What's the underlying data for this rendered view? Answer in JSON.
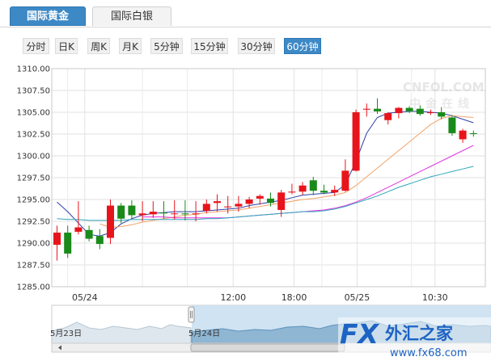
{
  "tabs": {
    "active_label": "国际黄金",
    "inactive_label": "国际白银"
  },
  "periods": [
    {
      "label": "分时",
      "selected": false
    },
    {
      "label": "日K",
      "selected": false
    },
    {
      "label": "周K",
      "selected": false
    },
    {
      "label": "月K",
      "selected": false
    },
    {
      "label": "5分钟",
      "selected": false
    },
    {
      "label": "15分钟",
      "selected": false
    },
    {
      "label": "30分钟",
      "selected": false
    },
    {
      "label": "60分钟",
      "selected": true
    }
  ],
  "watermarks": {
    "cnfol": "CNFOL.COM",
    "cnfol_sub": "中金在线",
    "fx": "FX",
    "fx_cn": "外汇之家",
    "fx_url": "www.fx68.com"
  },
  "navigator": {
    "labels": [
      "5月23日",
      "5月24日"
    ]
  },
  "colors": {
    "up": "#e8141b",
    "down": "#1a8a1a",
    "ma5": "#2f3fa8",
    "ma10": "#f3a268",
    "ma20": "#e236e2",
    "ma30": "#2ea6b8",
    "accent": "#3d89c6"
  },
  "chart_data": {
    "type": "candlestick",
    "title": "",
    "ylim": [
      1285,
      1310
    ],
    "yticks": [
      "1310.00",
      "1307.50",
      "1305.00",
      "1302.50",
      "1300.00",
      "1297.50",
      "1295.00",
      "1292.50",
      "1290.00",
      "1287.50",
      "1285.00"
    ],
    "xtick_labels": [
      {
        "label": "05/24",
        "index": 2.6
      },
      {
        "label": "12:00",
        "index": 16.5
      },
      {
        "label": "18:00",
        "index": 22.2
      },
      {
        "label": "05/25",
        "index": 28.1
      },
      {
        "label": "10:30",
        "index": 35.4
      }
    ],
    "grid": true,
    "candles": [
      {
        "o": 1289.8,
        "h": 1292.0,
        "l": 1288.0,
        "c": 1291.2
      },
      {
        "o": 1291.2,
        "h": 1292.0,
        "l": 1288.3,
        "c": 1288.8
      },
      {
        "o": 1291.3,
        "h": 1294.8,
        "l": 1291.0,
        "c": 1291.8
      },
      {
        "o": 1291.5,
        "h": 1292.0,
        "l": 1290.2,
        "c": 1290.5
      },
      {
        "o": 1290.8,
        "h": 1291.6,
        "l": 1289.3,
        "c": 1289.9
      },
      {
        "o": 1290.6,
        "h": 1295.0,
        "l": 1289.9,
        "c": 1294.3
      },
      {
        "o": 1294.3,
        "h": 1294.6,
        "l": 1292.3,
        "c": 1292.8
      },
      {
        "o": 1294.3,
        "h": 1294.9,
        "l": 1292.8,
        "c": 1293.2
      },
      {
        "o": 1293.2,
        "h": 1294.8,
        "l": 1292.5,
        "c": 1293.4
      },
      {
        "o": 1293.3,
        "h": 1294.8,
        "l": 1292.9,
        "c": 1293.6
      },
      {
        "o": 1293.5,
        "h": 1294.8,
        "l": 1292.8,
        "c": 1293.4
      },
      {
        "o": 1293.4,
        "h": 1294.9,
        "l": 1292.7,
        "c": 1293.4
      },
      {
        "o": 1293.4,
        "h": 1294.9,
        "l": 1292.6,
        "c": 1293.3
      },
      {
        "o": 1293.3,
        "h": 1294.8,
        "l": 1292.5,
        "c": 1293.4
      },
      {
        "o": 1293.7,
        "h": 1295.0,
        "l": 1293.4,
        "c": 1294.5
      },
      {
        "o": 1294.6,
        "h": 1295.6,
        "l": 1293.6,
        "c": 1294.8
      },
      {
        "o": 1294.1,
        "h": 1295.4,
        "l": 1293.4,
        "c": 1294.2
      },
      {
        "o": 1294.2,
        "h": 1295.4,
        "l": 1293.6,
        "c": 1294.5
      },
      {
        "o": 1294.5,
        "h": 1295.3,
        "l": 1294.0,
        "c": 1295.0
      },
      {
        "o": 1295.1,
        "h": 1295.6,
        "l": 1294.4,
        "c": 1295.4
      },
      {
        "o": 1295.1,
        "h": 1295.8,
        "l": 1294.2,
        "c": 1294.6
      },
      {
        "o": 1293.8,
        "h": 1296.1,
        "l": 1293.0,
        "c": 1295.8
      },
      {
        "o": 1295.8,
        "h": 1296.8,
        "l": 1295.6,
        "c": 1295.9
      },
      {
        "o": 1295.9,
        "h": 1297.0,
        "l": 1295.5,
        "c": 1296.6
      },
      {
        "o": 1297.2,
        "h": 1297.6,
        "l": 1295.5,
        "c": 1296.0
      },
      {
        "o": 1296.0,
        "h": 1296.7,
        "l": 1295.6,
        "c": 1295.8
      },
      {
        "o": 1295.8,
        "h": 1296.6,
        "l": 1295.4,
        "c": 1296.1
      },
      {
        "o": 1296.0,
        "h": 1299.6,
        "l": 1295.9,
        "c": 1298.3
      },
      {
        "o": 1298.3,
        "h": 1305.3,
        "l": 1298.2,
        "c": 1305.0
      },
      {
        "o": 1305.3,
        "h": 1306.0,
        "l": 1304.5,
        "c": 1305.4
      },
      {
        "o": 1305.4,
        "h": 1306.6,
        "l": 1304.8,
        "c": 1305.1
      },
      {
        "o": 1304.1,
        "h": 1305.0,
        "l": 1303.6,
        "c": 1304.9
      },
      {
        "o": 1304.9,
        "h": 1305.6,
        "l": 1304.3,
        "c": 1305.5
      },
      {
        "o": 1305.5,
        "h": 1305.7,
        "l": 1304.9,
        "c": 1305.1
      },
      {
        "o": 1305.4,
        "h": 1305.8,
        "l": 1304.6,
        "c": 1304.8
      },
      {
        "o": 1304.9,
        "h": 1305.3,
        "l": 1304.7,
        "c": 1305.0
      },
      {
        "o": 1305.0,
        "h": 1305.6,
        "l": 1304.2,
        "c": 1304.5
      },
      {
        "o": 1304.4,
        "h": 1304.7,
        "l": 1302.3,
        "c": 1302.6
      },
      {
        "o": 1301.9,
        "h": 1303.1,
        "l": 1301.5,
        "c": 1302.9
      },
      {
        "o": 1302.6,
        "h": 1302.9,
        "l": 1302.2,
        "c": 1302.5
      }
    ],
    "series": [
      {
        "values": [
          1294.7,
          1293.6,
          1292.3,
          1291.0,
          1290.8,
          1291.2,
          1292.2,
          1292.8,
          1293.2,
          1293.4,
          1293.5,
          1293.6,
          1293.6,
          1293.6,
          1293.7,
          1293.8,
          1293.9,
          1294.0,
          1294.3,
          1294.5,
          1294.7,
          1294.9,
          1295.2,
          1295.5,
          1295.6,
          1295.7,
          1295.8,
          1296.7,
          1299.4,
          1302.6,
          1304.4,
          1304.9,
          1305.0,
          1305.1,
          1305.1,
          1305.0,
          1304.9,
          1304.6,
          1304.2,
          1303.8
        ]
      },
      {
        "values": [
          null,
          null,
          null,
          null,
          1292.2,
          1291.8,
          1291.9,
          1292.1,
          1292.4,
          1292.6,
          1292.8,
          1293.0,
          1293.2,
          1293.3,
          1293.5,
          1293.6,
          1293.7,
          1293.8,
          1294.0,
          1294.2,
          1294.4,
          1294.6,
          1294.8,
          1295.0,
          1295.1,
          1295.3,
          1295.5,
          1295.8,
          1296.6,
          1297.6,
          1298.6,
          1299.6,
          1300.6,
          1301.6,
          1302.6,
          1303.6,
          1304.3,
          1304.6,
          1304.5,
          1304.4
        ]
      },
      {
        "values": [
          null,
          null,
          null,
          null,
          null,
          null,
          null,
          null,
          1293.0,
          1293.0,
          1293.0,
          1292.9,
          1292.9,
          1292.9,
          1292.9,
          1292.9,
          1292.9,
          1293.0,
          1293.1,
          1293.2,
          1293.3,
          1293.4,
          1293.5,
          1293.6,
          1293.7,
          1293.8,
          1294.0,
          1294.3,
          1294.7,
          1295.2,
          1295.8,
          1296.4,
          1297.0,
          1297.6,
          1298.2,
          1298.8,
          1299.4,
          1300.0,
          1300.6,
          1301.2
        ]
      },
      {
        "values": [
          1292.8,
          1292.7,
          1292.7,
          1292.6,
          1292.6,
          1292.6,
          1292.6,
          1292.7,
          1292.7,
          1292.7,
          1292.7,
          1292.7,
          1292.7,
          1292.7,
          1292.8,
          1292.8,
          1292.9,
          1293.0,
          1293.1,
          1293.2,
          1293.3,
          1293.4,
          1293.5,
          1293.6,
          1293.6,
          1293.7,
          1293.9,
          1294.2,
          1294.6,
          1295.0,
          1295.4,
          1295.9,
          1296.4,
          1296.8,
          1297.2,
          1297.6,
          1297.9,
          1298.2,
          1298.5,
          1298.8
        ]
      }
    ]
  }
}
